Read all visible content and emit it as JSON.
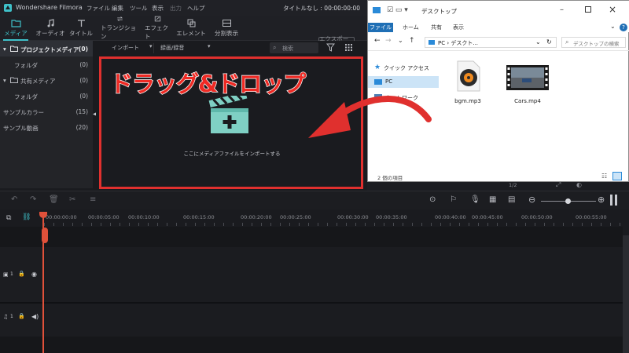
{
  "app": {
    "name": "Wondershare Filmora",
    "menus": [
      "ファイル",
      "編集",
      "ツール",
      "表示",
      "出力",
      "ヘルプ"
    ],
    "project_title": "タイトルなし : 00:00:00:00"
  },
  "toolbar": {
    "items": [
      "メディア",
      "オーディオ",
      "タイトル",
      "トランジション",
      "エフェクト",
      "エレメント",
      "分割表示"
    ],
    "export_label": "エクスポート"
  },
  "sidebar": {
    "items": [
      {
        "label": "プロジェクトメディア",
        "count": "(0)"
      },
      {
        "label": "フォルダ",
        "count": "(0)"
      },
      {
        "label": "共有メディア",
        "count": "(0)"
      },
      {
        "label": "フォルダ",
        "count": "(0)"
      },
      {
        "label": "サンプルカラー",
        "count": "(15)"
      },
      {
        "label": "サンプル動画",
        "count": "(20)"
      }
    ]
  },
  "media": {
    "import_label": "インポート",
    "record_label": "録画/録音",
    "search_placeholder": "検索",
    "import_hint": "ここにメディアファイルをインポートする"
  },
  "overlay": {
    "title": "ドラッグ&ドロップ",
    "accent": "#e0302e"
  },
  "explorer": {
    "title": "デスクトップ",
    "tabs": [
      "ファイル",
      "ホーム",
      "共有",
      "表示"
    ],
    "path": "PC › デスクト...",
    "search_placeholder": "デスクトップの検索",
    "nav": [
      "クイック アクセス",
      "PC",
      "ネットワーク"
    ],
    "files": [
      {
        "name": "bgm.mp3",
        "icon": "audio-file-icon"
      },
      {
        "name": "Cars.mp4",
        "icon": "video-file-icon"
      }
    ],
    "status": "2 個の項目"
  },
  "preview": {
    "page": "1/2"
  },
  "timeline": {
    "ticks": [
      "00:00:00:00",
      "00:00:05:00",
      "00:00:10:00",
      "00:00:15:00",
      "00:00:20:00",
      "00:00:25:00",
      "00:00:30:00",
      "00:00:35:00",
      "00:00:40:00",
      "00:00:45:00",
      "00:00:50:00",
      "00:00:55:00"
    ],
    "video_track": "1",
    "audio_track": "1"
  }
}
